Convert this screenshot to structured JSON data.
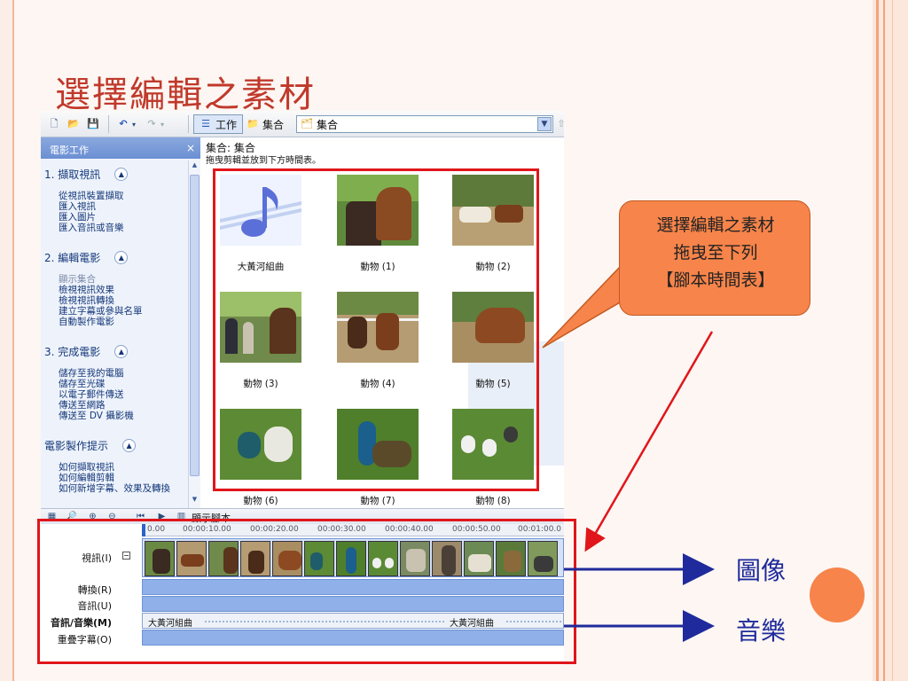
{
  "slide": {
    "title": "選擇編輯之素材",
    "callout": [
      "選擇編輯之素材",
      "拖曳至下列",
      "【腳本時間表】"
    ],
    "label_image": "圖像",
    "label_music": "音樂"
  },
  "toolbar": {
    "tab_work": "工作",
    "tab_collection": "集合",
    "collection_select": "集合"
  },
  "task_pane": {
    "title": "電影工作",
    "sections": [
      {
        "heading": "1. 擷取視訊",
        "links": [
          "從視訊裝置擷取",
          "匯入視訊",
          "匯入圖片",
          "匯入音訊或音樂"
        ]
      },
      {
        "heading": "2. 編輯電影",
        "links": [
          "顯示集合",
          "檢視視訊效果",
          "檢視視訊轉換",
          "建立字幕或參與名單",
          "自動製作電影"
        ]
      },
      {
        "heading": "3. 完成電影",
        "links": [
          "儲存至我的電腦",
          "儲存至光碟",
          "以電子郵件傳送",
          "傳送至網路",
          "傳送至 DV 攝影機"
        ]
      },
      {
        "heading": "電影製作提示",
        "links": [
          "如何擷取視訊",
          "如何編輯剪輯",
          "如何新增字幕、效果及轉換"
        ]
      }
    ]
  },
  "collection": {
    "header": "集合: 集合",
    "subheader": "拖曳剪輯並放到下方時間表。",
    "clips": [
      "大黃河組曲",
      "動物 (1)",
      "動物 (2)",
      "動物 (3)",
      "動物 (4)",
      "動物 (5)",
      "動物 (6)",
      "動物 (7)",
      "動物 (8)"
    ]
  },
  "timeline_toolbar": {
    "show_storyboard": "顯示腳本"
  },
  "timeline": {
    "ruler": [
      "0.00",
      "00:00:10.00",
      "00:00:20.00",
      "00:00:30.00",
      "00:00:40.00",
      "00:00:50.00",
      "00:01:00.0"
    ],
    "tracks": {
      "video": "視訊(I)",
      "transition": "轉換(R)",
      "audio": "音訊(U)",
      "audio_music": "音訊/音樂(M)",
      "title_overlay": "重疊字幕(O)"
    },
    "music_clips": [
      "大黃河組曲",
      "大黃河組曲"
    ]
  },
  "colors": {
    "highlight": "#e0161b",
    "callout": "#f7844a",
    "arrow": "#1f2a9c",
    "title": "#c0392b"
  },
  "icons": [
    "new-icon",
    "open-icon",
    "save-icon",
    "undo-icon",
    "redo-icon",
    "tasks-icon",
    "collections-icon",
    "up-folder-icon",
    "collapse-icon",
    "close-icon",
    "magnify-icon",
    "zoom-in-icon",
    "zoom-out-icon",
    "rewind-icon",
    "play-icon",
    "storyboard-icon"
  ]
}
